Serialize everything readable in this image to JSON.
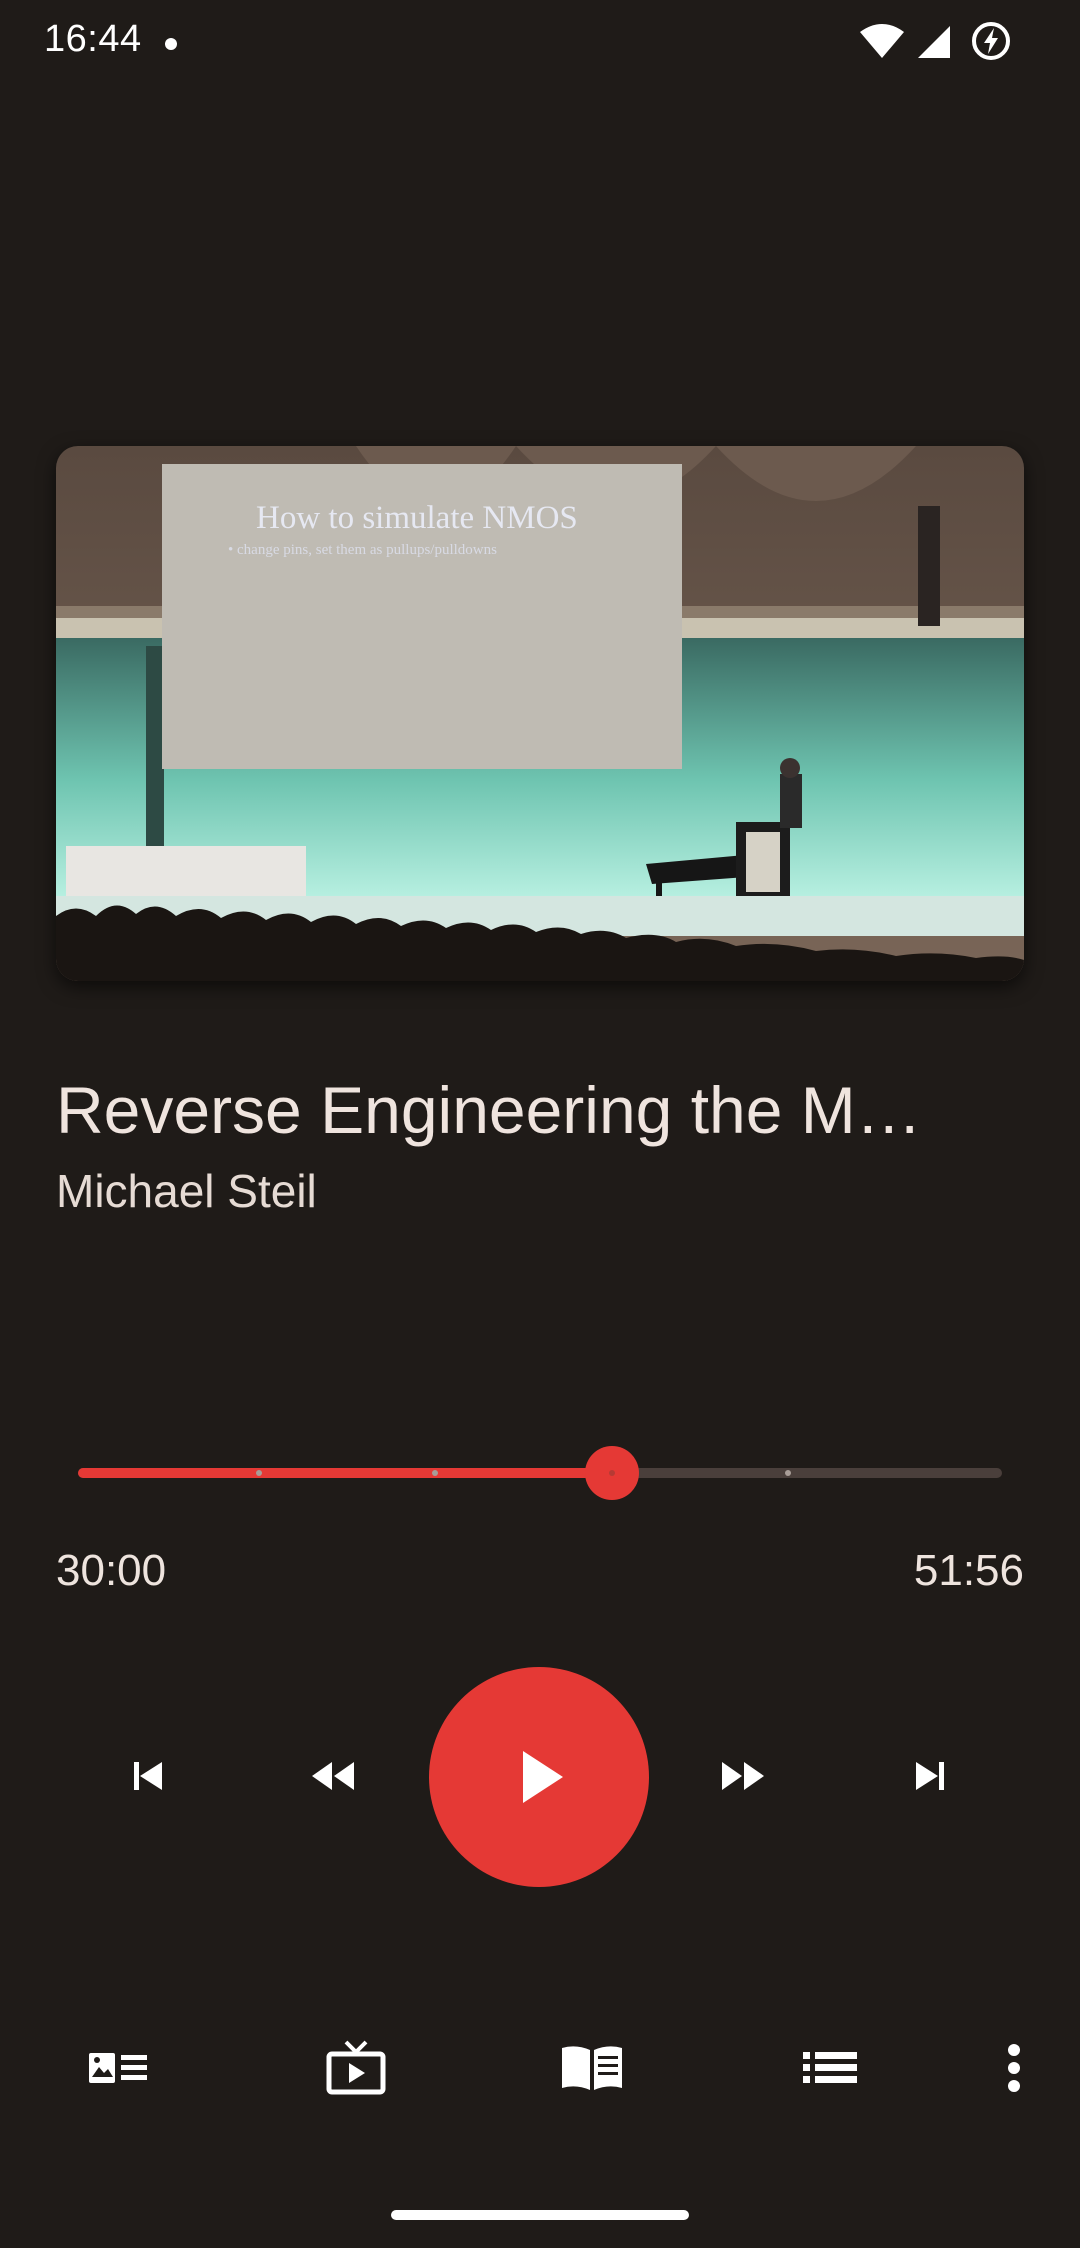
{
  "status_bar": {
    "time": "16:44"
  },
  "artwork": {
    "slide_title": "How to simulate NMOS",
    "slide_bullet": "•  change pins, set them as pullups/pulldowns"
  },
  "track": {
    "title": "Reverse Engineering the M…",
    "artist": "Michael Steil"
  },
  "playback": {
    "elapsed": "30:00",
    "total": "51:56",
    "progress": 0.578,
    "chapter_marks": [
      0.196,
      0.386,
      0.768
    ]
  },
  "controls": {
    "previous": "skip-previous-icon",
    "rewind": "rewind-icon",
    "play": "play-icon",
    "fast_forward": "fast-forward-icon",
    "next": "skip-next-icon"
  },
  "bottom_nav": [
    "description-icon",
    "video-icon",
    "chapters-book-icon",
    "queue-list-icon",
    "more-vert-icon"
  ],
  "colors": {
    "background": "#1f1b18",
    "accent": "#e53935",
    "text": "#efe4de"
  }
}
